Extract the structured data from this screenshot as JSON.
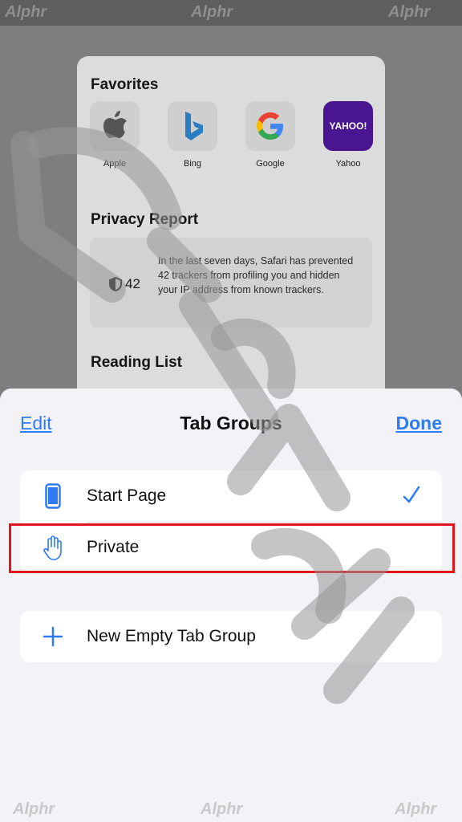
{
  "watermark": {
    "text": "Alphr"
  },
  "start_page": {
    "favorites_title": "Favorites",
    "favorites": [
      {
        "label": "Apple",
        "icon": "apple-logo-icon"
      },
      {
        "label": "Bing",
        "icon": "bing-logo-icon"
      },
      {
        "label": "Google",
        "icon": "google-logo-icon"
      },
      {
        "label": "Yahoo",
        "icon": "yahoo-logo-icon",
        "tile_text": "YAHOO!",
        "tile_color": "#5f01d1"
      }
    ],
    "privacy_title": "Privacy Report",
    "privacy_count": "42",
    "privacy_text": "In the last seven days, Safari has prevented 42 trackers from profiling you and hidden your IP address from known trackers.",
    "reading_title": "Reading List"
  },
  "sheet": {
    "edit_label": "Edit",
    "title": "Tab Groups",
    "done_label": "Done",
    "groups": [
      {
        "label": "Start Page",
        "icon": "phone-icon",
        "selected": true
      },
      {
        "label": "Private",
        "icon": "hand-icon",
        "selected": false
      }
    ],
    "new_group_label": "New Empty Tab Group"
  },
  "colors": {
    "accent": "#2f7bf6",
    "highlight": "#e0161c"
  }
}
